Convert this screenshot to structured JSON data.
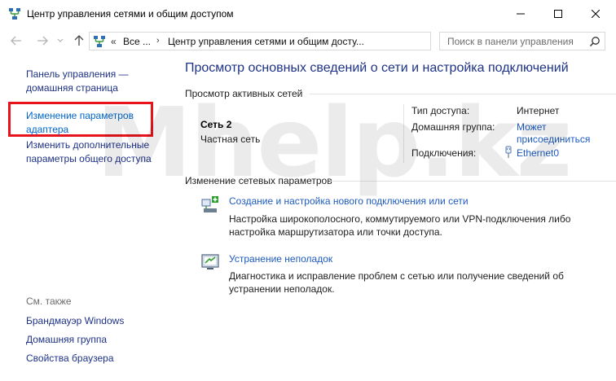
{
  "window": {
    "title": "Центр управления сетями и общим доступом",
    "icon": "network-center-icon"
  },
  "address": {
    "separator": "«",
    "crumb1": "Все ...",
    "arrow": "›",
    "crumb2": "Центр управления сетями и общим досту..."
  },
  "search": {
    "placeholder": "Поиск в панели управления"
  },
  "sidebar": {
    "home": "Панель управления — домашняя страница",
    "adapter": "Изменение параметров адаптера",
    "sharing": "Изменить дополнительные параметры общего доступа",
    "see_also": "См. также",
    "firewall": "Брандмауэр Windows",
    "homegroup": "Домашняя группа",
    "browser": "Свойства браузера"
  },
  "main": {
    "title": "Просмотр основных сведений о сети и настройка подключений",
    "active_section": "Просмотр активных сетей",
    "network_name": "Сеть  2",
    "network_type": "Частная сеть",
    "access_label": "Тип доступа:",
    "access_value": "Интернет",
    "homegroup_label": "Домашняя группа:",
    "homegroup_value": "Может присоединиться",
    "connections_label": "Подключения:",
    "connections_value": "Ethernet0",
    "change_section": "Изменение сетевых параметров",
    "task1_link": "Создание и настройка нового подключения или сети",
    "task1_desc": "Настройка широкополосного, коммутируемого или VPN-подключения либо настройка маршрутизатора или точки доступа.",
    "task2_link": "Устранение неполадок",
    "task2_desc": "Диагностика и исправление проблем с сетью или получение сведений об устранении неполадок."
  },
  "watermark": "Mhelp.kz",
  "colors": {
    "link": "#1e5bbf",
    "nav_link": "#1e3287",
    "highlight": "#e8141c"
  }
}
